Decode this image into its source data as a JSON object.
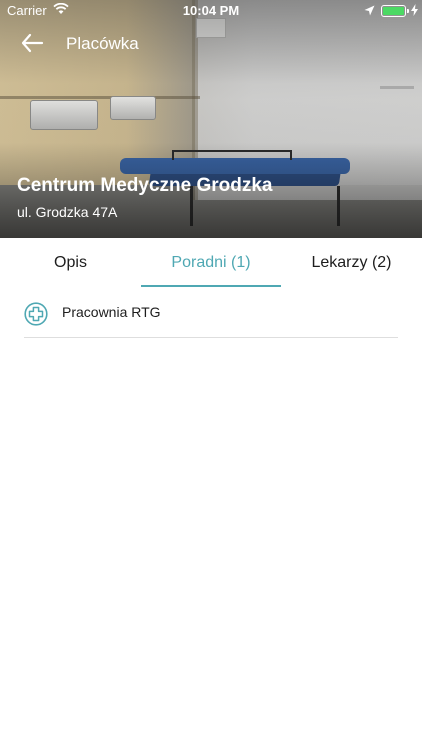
{
  "status_bar": {
    "carrier": "Carrier",
    "time": "10:04 PM",
    "battery_color": "#4cd964"
  },
  "nav": {
    "back_icon": "arrow-left-icon",
    "title": "Placówka"
  },
  "facility": {
    "name": "Centrum Medyczne Grodzka",
    "address": "ul. Grodzka 47A"
  },
  "tabs": [
    {
      "label": "Opis",
      "active": false
    },
    {
      "label": "Poradni (1)",
      "active": true
    },
    {
      "label": "Lekarzy (2)",
      "active": false
    }
  ],
  "clinics": [
    {
      "icon": "plus-circle-icon",
      "label": "Pracownia RTG"
    }
  ],
  "colors": {
    "accent": "#4fa8b3",
    "text": "#1d1d1d",
    "divider": "#dedede"
  }
}
